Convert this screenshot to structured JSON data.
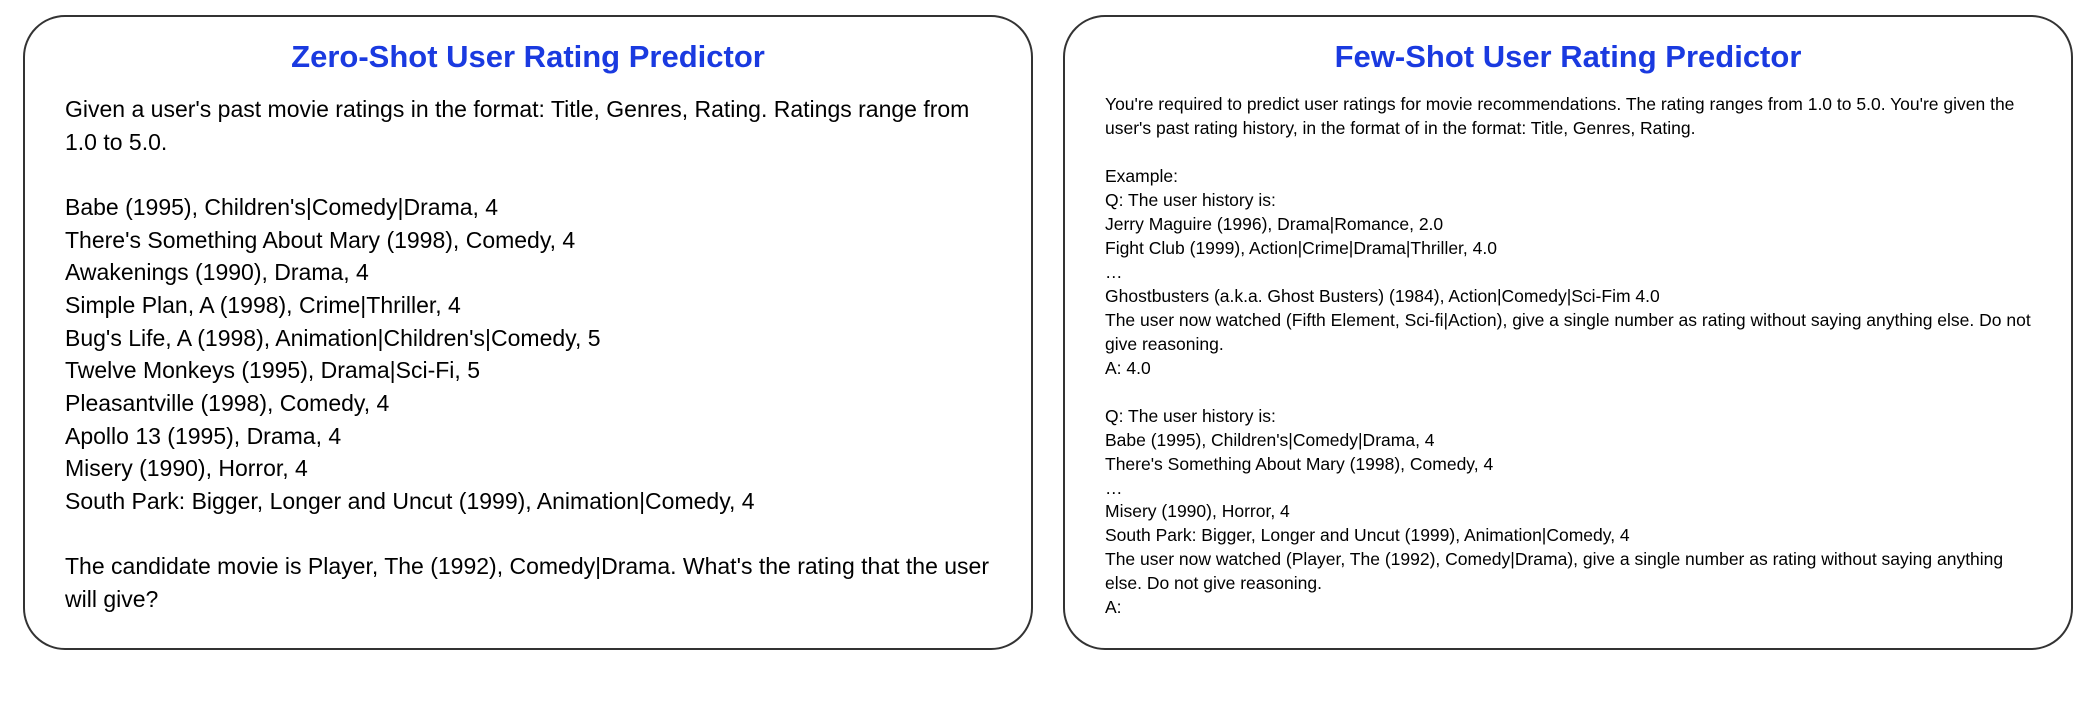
{
  "left": {
    "title": "Zero-Shot User Rating Predictor",
    "intro": "Given a user's past movie ratings in the format: Title, Genres, Rating. Ratings range from 1.0 to 5.0.",
    "ratings": [
      "Babe (1995), Children's|Comedy|Drama, 4",
      "There's Something About Mary (1998), Comedy, 4",
      "Awakenings (1990), Drama, 4",
      "Simple Plan, A (1998), Crime|Thriller, 4",
      "Bug's Life, A (1998), Animation|Children's|Comedy, 5",
      "Twelve Monkeys (1995), Drama|Sci-Fi, 5",
      "Pleasantville (1998), Comedy, 4",
      "Apollo 13 (1995), Drama, 4",
      "Misery (1990), Horror, 4",
      "South Park: Bigger, Longer and Uncut (1999), Animation|Comedy, 4"
    ],
    "question": "The candidate movie is Player, The (1992), Comedy|Drama. What's the rating that the user will give?"
  },
  "right": {
    "title": "Few-Shot User Rating Predictor",
    "intro": "You're required to predict user ratings for movie recommendations. The rating ranges from 1.0 to 5.0. You're given the user's past rating history, in the format of in the format: Title, Genres, Rating.",
    "example_label": "Example:",
    "ex1_q": "Q: The user history is:",
    "ex1_history": [
      "Jerry Maguire (1996), Drama|Romance, 2.0",
      "Fight Club (1999), Action|Crime|Drama|Thriller, 4.0",
      "…",
      "Ghostbusters (a.k.a. Ghost Busters) (1984), Action|Comedy|Sci-Fim 4.0"
    ],
    "ex1_prompt": "The user now watched (Fifth Element, Sci-fi|Action), give a single number as rating without saying anything else. Do not give reasoning.",
    "ex1_answer": "A: 4.0",
    "ex2_q": "Q: The user history is:",
    "ex2_history": [
      "Babe (1995), Children's|Comedy|Drama, 4",
      "There's Something About Mary (1998), Comedy, 4",
      "…",
      "Misery (1990), Horror, 4",
      "South Park: Bigger, Longer and Uncut (1999), Animation|Comedy, 4"
    ],
    "ex2_prompt": "The user now watched (Player, The (1992), Comedy|Drama), give a single number as rating without saying anything else. Do not give reasoning.",
    "ex2_answer": "A:"
  }
}
